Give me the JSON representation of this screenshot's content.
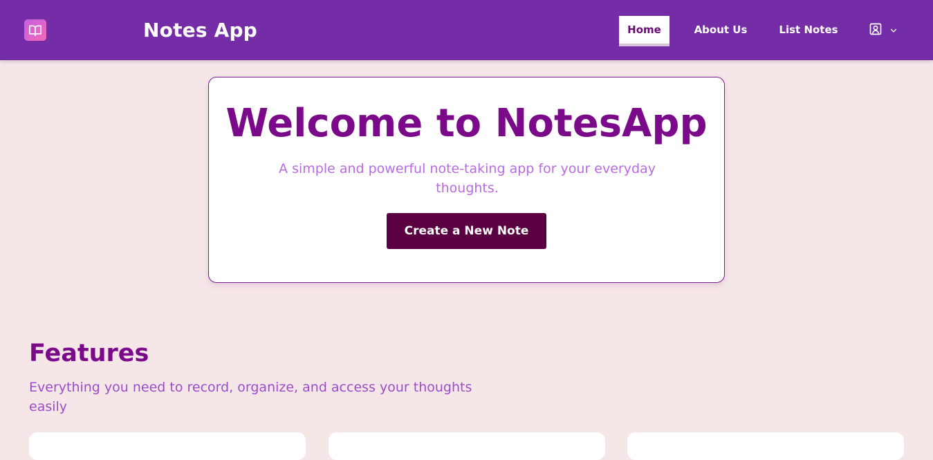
{
  "navbar": {
    "brand": "Notes App",
    "links": [
      {
        "label": "Home",
        "active": true
      },
      {
        "label": "About Us",
        "active": false
      },
      {
        "label": "List Notes",
        "active": false
      }
    ],
    "logo_icon": "book-open-icon",
    "user_icon": "user-square-icon",
    "dropdown_icon": "chevron-down-icon"
  },
  "hero": {
    "title": "Welcome to NotesApp",
    "subtitle": "A simple and powerful note-taking app for your everyday thoughts.",
    "cta_label": "Create a New Note"
  },
  "features": {
    "title": "Features",
    "subtitle": "Everything you need to record, organize, and access your thoughts easily"
  },
  "colors": {
    "nav_bg": "#742da6",
    "page_bg": "#f5e6e8",
    "accent": "#7a0a8a",
    "cta_bg": "#5a0042",
    "subtitle": "#b86be0"
  }
}
